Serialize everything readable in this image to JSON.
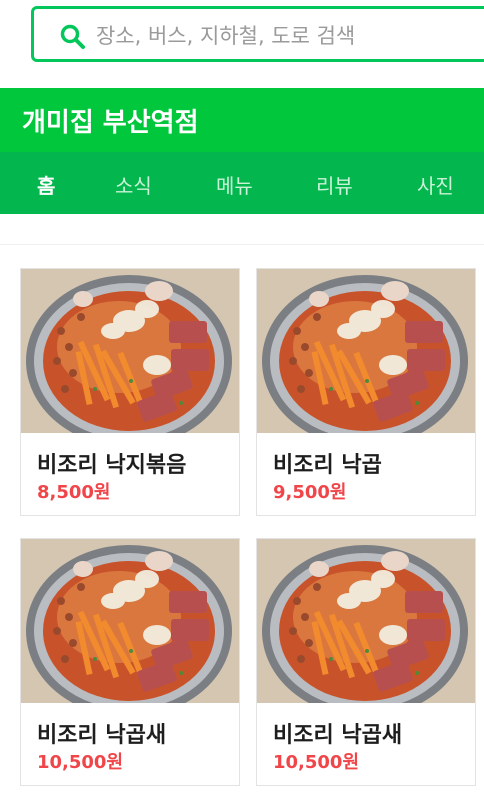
{
  "search": {
    "placeholder": "장소, 버스, 지하철, 도로 검색"
  },
  "place": {
    "name": "개미집 부산역점"
  },
  "tabs": [
    {
      "label": "홈"
    },
    {
      "label": "소식"
    },
    {
      "label": "메뉴"
    },
    {
      "label": "리뷰"
    },
    {
      "label": "사진"
    }
  ],
  "menu": {
    "items": [
      {
        "name": "비조리 낙지볶음",
        "price": "8,500원"
      },
      {
        "name": "비조리 낙곱",
        "price": "9,500원"
      },
      {
        "name": "비조리 낙곱새",
        "price": "10,500원"
      },
      {
        "name": "비조리 낙곱새",
        "price": "10,500원"
      }
    ]
  },
  "colors": {
    "brand": "#00c73c",
    "tabbar": "#03b74e",
    "price": "#f0464a"
  }
}
